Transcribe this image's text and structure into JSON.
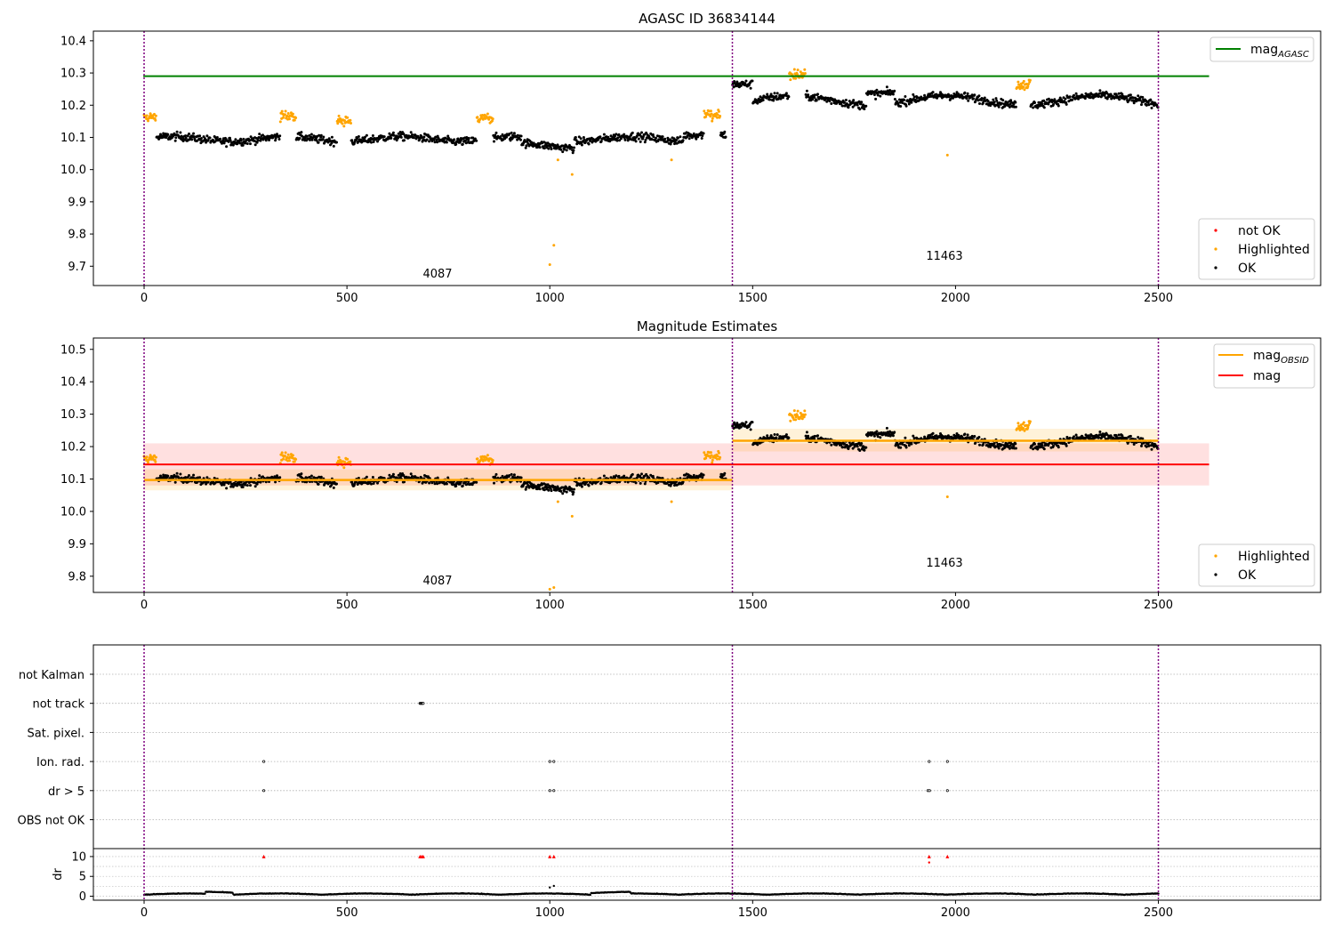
{
  "chart_data": [
    {
      "type": "scatter",
      "title": "AGASC ID 36834144",
      "xlim": [
        -125,
        2900
      ],
      "ylim": [
        9.64,
        10.43
      ],
      "xticks": [
        "0",
        "500",
        "1000",
        "1500",
        "2000",
        "2500"
      ],
      "yticks": [
        "10.4",
        "10.3",
        "10.2",
        "10.1",
        "10.0",
        "9.9",
        "9.8",
        "9.7"
      ],
      "obs_boundaries": [
        0,
        1450,
        2500
      ],
      "obsids": [
        "4087",
        "11463"
      ],
      "reference_line": {
        "name": "mag_AGASC",
        "value": 10.29,
        "color": "#008000"
      },
      "legend_lines": [
        {
          "main": "mag",
          "sub": "AGASC"
        }
      ],
      "legend_points": [
        {
          "label": "not OK",
          "color": "#ff0000"
        },
        {
          "label": "Highlighted",
          "color": "#ffa500"
        },
        {
          "label": "OK",
          "color": "#000000"
        }
      ],
      "outliers": [
        {
          "x": 1000,
          "y": 9.705
        },
        {
          "x": 1010,
          "y": 9.765
        },
        {
          "x": 1020,
          "y": 10.03
        },
        {
          "x": 1055,
          "y": 9.985
        },
        {
          "x": 1300,
          "y": 10.03
        },
        {
          "x": 1980,
          "y": 10.045
        }
      ]
    },
    {
      "type": "scatter",
      "title": "Magnitude Estimates",
      "xlim": [
        -125,
        2900
      ],
      "ylim": [
        9.75,
        10.535
      ],
      "xticks": [
        "0",
        "500",
        "1000",
        "1500",
        "2000",
        "2500"
      ],
      "yticks": [
        "10.5",
        "10.4",
        "10.3",
        "10.2",
        "10.1",
        "10.0",
        "9.9",
        "9.8"
      ],
      "obs_boundaries": [
        0,
        1450,
        2500
      ],
      "obsids": [
        "4087",
        "11463"
      ],
      "mag": {
        "value": 10.145,
        "band": [
          10.08,
          10.21
        ],
        "color": "#ff0000"
      },
      "mag_obsid": [
        {
          "x": [
            0,
            1450
          ],
          "value": 10.097,
          "band": [
            10.065,
            10.13
          ],
          "color": "#ffa500"
        },
        {
          "x": [
            1450,
            2500
          ],
          "value": 10.218,
          "band": [
            10.185,
            10.255
          ],
          "color": "#ffa500"
        }
      ],
      "legend_lines": [
        {
          "main": "mag",
          "sub": "OBSID"
        },
        {
          "main": "mag",
          "sub": ""
        }
      ],
      "legend_points": [
        {
          "label": "Highlighted",
          "color": "#ffa500"
        },
        {
          "label": "OK",
          "color": "#000000"
        }
      ],
      "outliers": [
        {
          "x": 1000,
          "y": 9.76
        },
        {
          "x": 1010,
          "y": 9.765
        },
        {
          "x": 1020,
          "y": 10.03
        },
        {
          "x": 1055,
          "y": 9.985
        },
        {
          "x": 1300,
          "y": 10.03
        },
        {
          "x": 1980,
          "y": 10.045
        }
      ]
    },
    {
      "type": "scatter",
      "title": "",
      "xlim": [
        -125,
        2900
      ],
      "xticks": [
        "0",
        "500",
        "1000",
        "1500",
        "2000",
        "2500"
      ],
      "obs_boundaries": [
        0,
        1450,
        2500
      ],
      "flag_categories": [
        "not Kalman",
        "not track",
        "Sat. pixel.",
        "Ion. rad.",
        "dr > 5",
        "OBS not OK"
      ],
      "flag_points": [
        {
          "category": "not track",
          "x": [
            680,
            682,
            684,
            686,
            688
          ]
        },
        {
          "category": "Ion. rad.",
          "x": [
            295,
            1000,
            1010,
            1935,
            1980
          ]
        },
        {
          "category": "dr > 5",
          "x": [
            295,
            1000,
            1010,
            1932,
            1936,
            1980
          ]
        }
      ],
      "dr": {
        "ylabel": "dr",
        "ylim": [
          -1,
          12
        ],
        "yticks": [
          "10",
          "5",
          "0"
        ],
        "capped_value": 10,
        "capped_x": [
          295,
          680,
          684,
          688,
          1000,
          1010,
          1935,
          1980
        ],
        "outliers": [
          {
            "x": 1935,
            "y": 8.5
          },
          {
            "x": 1000,
            "y": 2.2
          },
          {
            "x": 1010,
            "y": 2.6
          }
        ]
      }
    }
  ]
}
